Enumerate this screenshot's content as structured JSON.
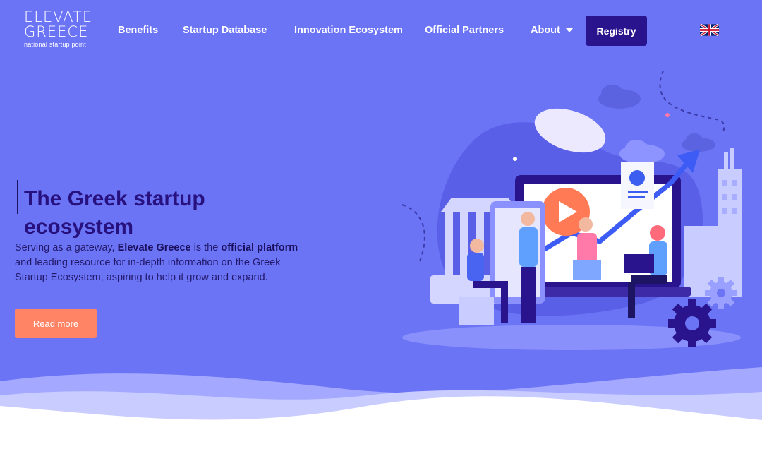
{
  "logo": {
    "line1": "ELEVATE",
    "line2": "GREECE",
    "line3": "national startup point"
  },
  "nav": {
    "items": [
      {
        "label": "Benefits"
      },
      {
        "label": "Startup Database"
      },
      {
        "label": "Innovation Ecosystem"
      },
      {
        "label": "Official Partners"
      },
      {
        "label": "About"
      }
    ],
    "registry_label": "Registry",
    "language_icon": "uk-flag-icon"
  },
  "hero": {
    "title": "The Greek startup ecosystem",
    "desc_part1": "Serving as a gateway, ",
    "desc_bold1": "Elevate Greece",
    "desc_part2": " is the ",
    "desc_bold2": "official platform",
    "desc_part3": " and leading resource for in-depth information on the Greek Startup Ecosystem, aspiring to help it grow and expand.",
    "read_more_label": "Read more"
  },
  "colors": {
    "background": "#6c74f6",
    "registry_button": "#2a148e",
    "read_more_button": "#ff8466",
    "title": "#27117f"
  }
}
